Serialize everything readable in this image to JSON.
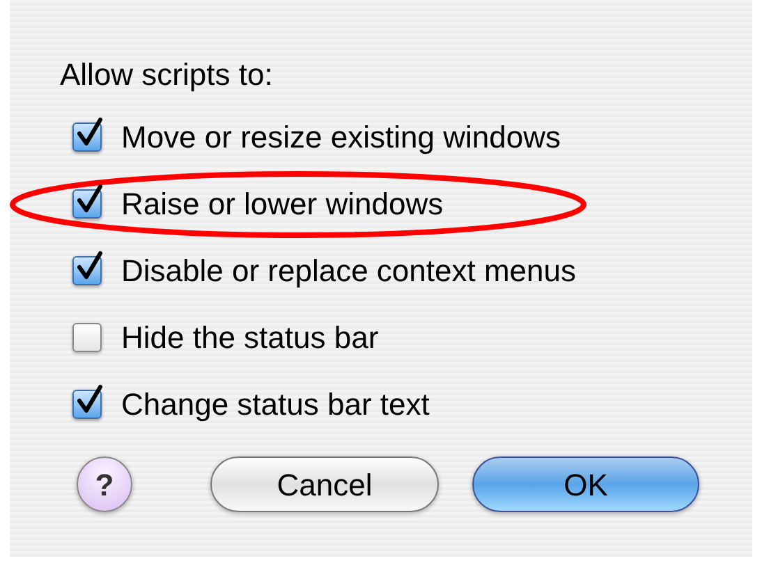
{
  "heading": "Allow scripts to:",
  "options": [
    {
      "label": "Move or resize existing windows",
      "checked": true,
      "highlighted": false
    },
    {
      "label": "Raise or lower windows",
      "checked": true,
      "highlighted": true
    },
    {
      "label": "Disable or replace context menus",
      "checked": true,
      "highlighted": false
    },
    {
      "label": "Hide the status bar",
      "checked": false,
      "highlighted": false
    },
    {
      "label": "Change status bar text",
      "checked": true,
      "highlighted": false
    }
  ],
  "help_button": "?",
  "buttons": [
    {
      "label": "Cancel",
      "kind": "secondary"
    },
    {
      "label": "OK",
      "kind": "default"
    }
  ]
}
